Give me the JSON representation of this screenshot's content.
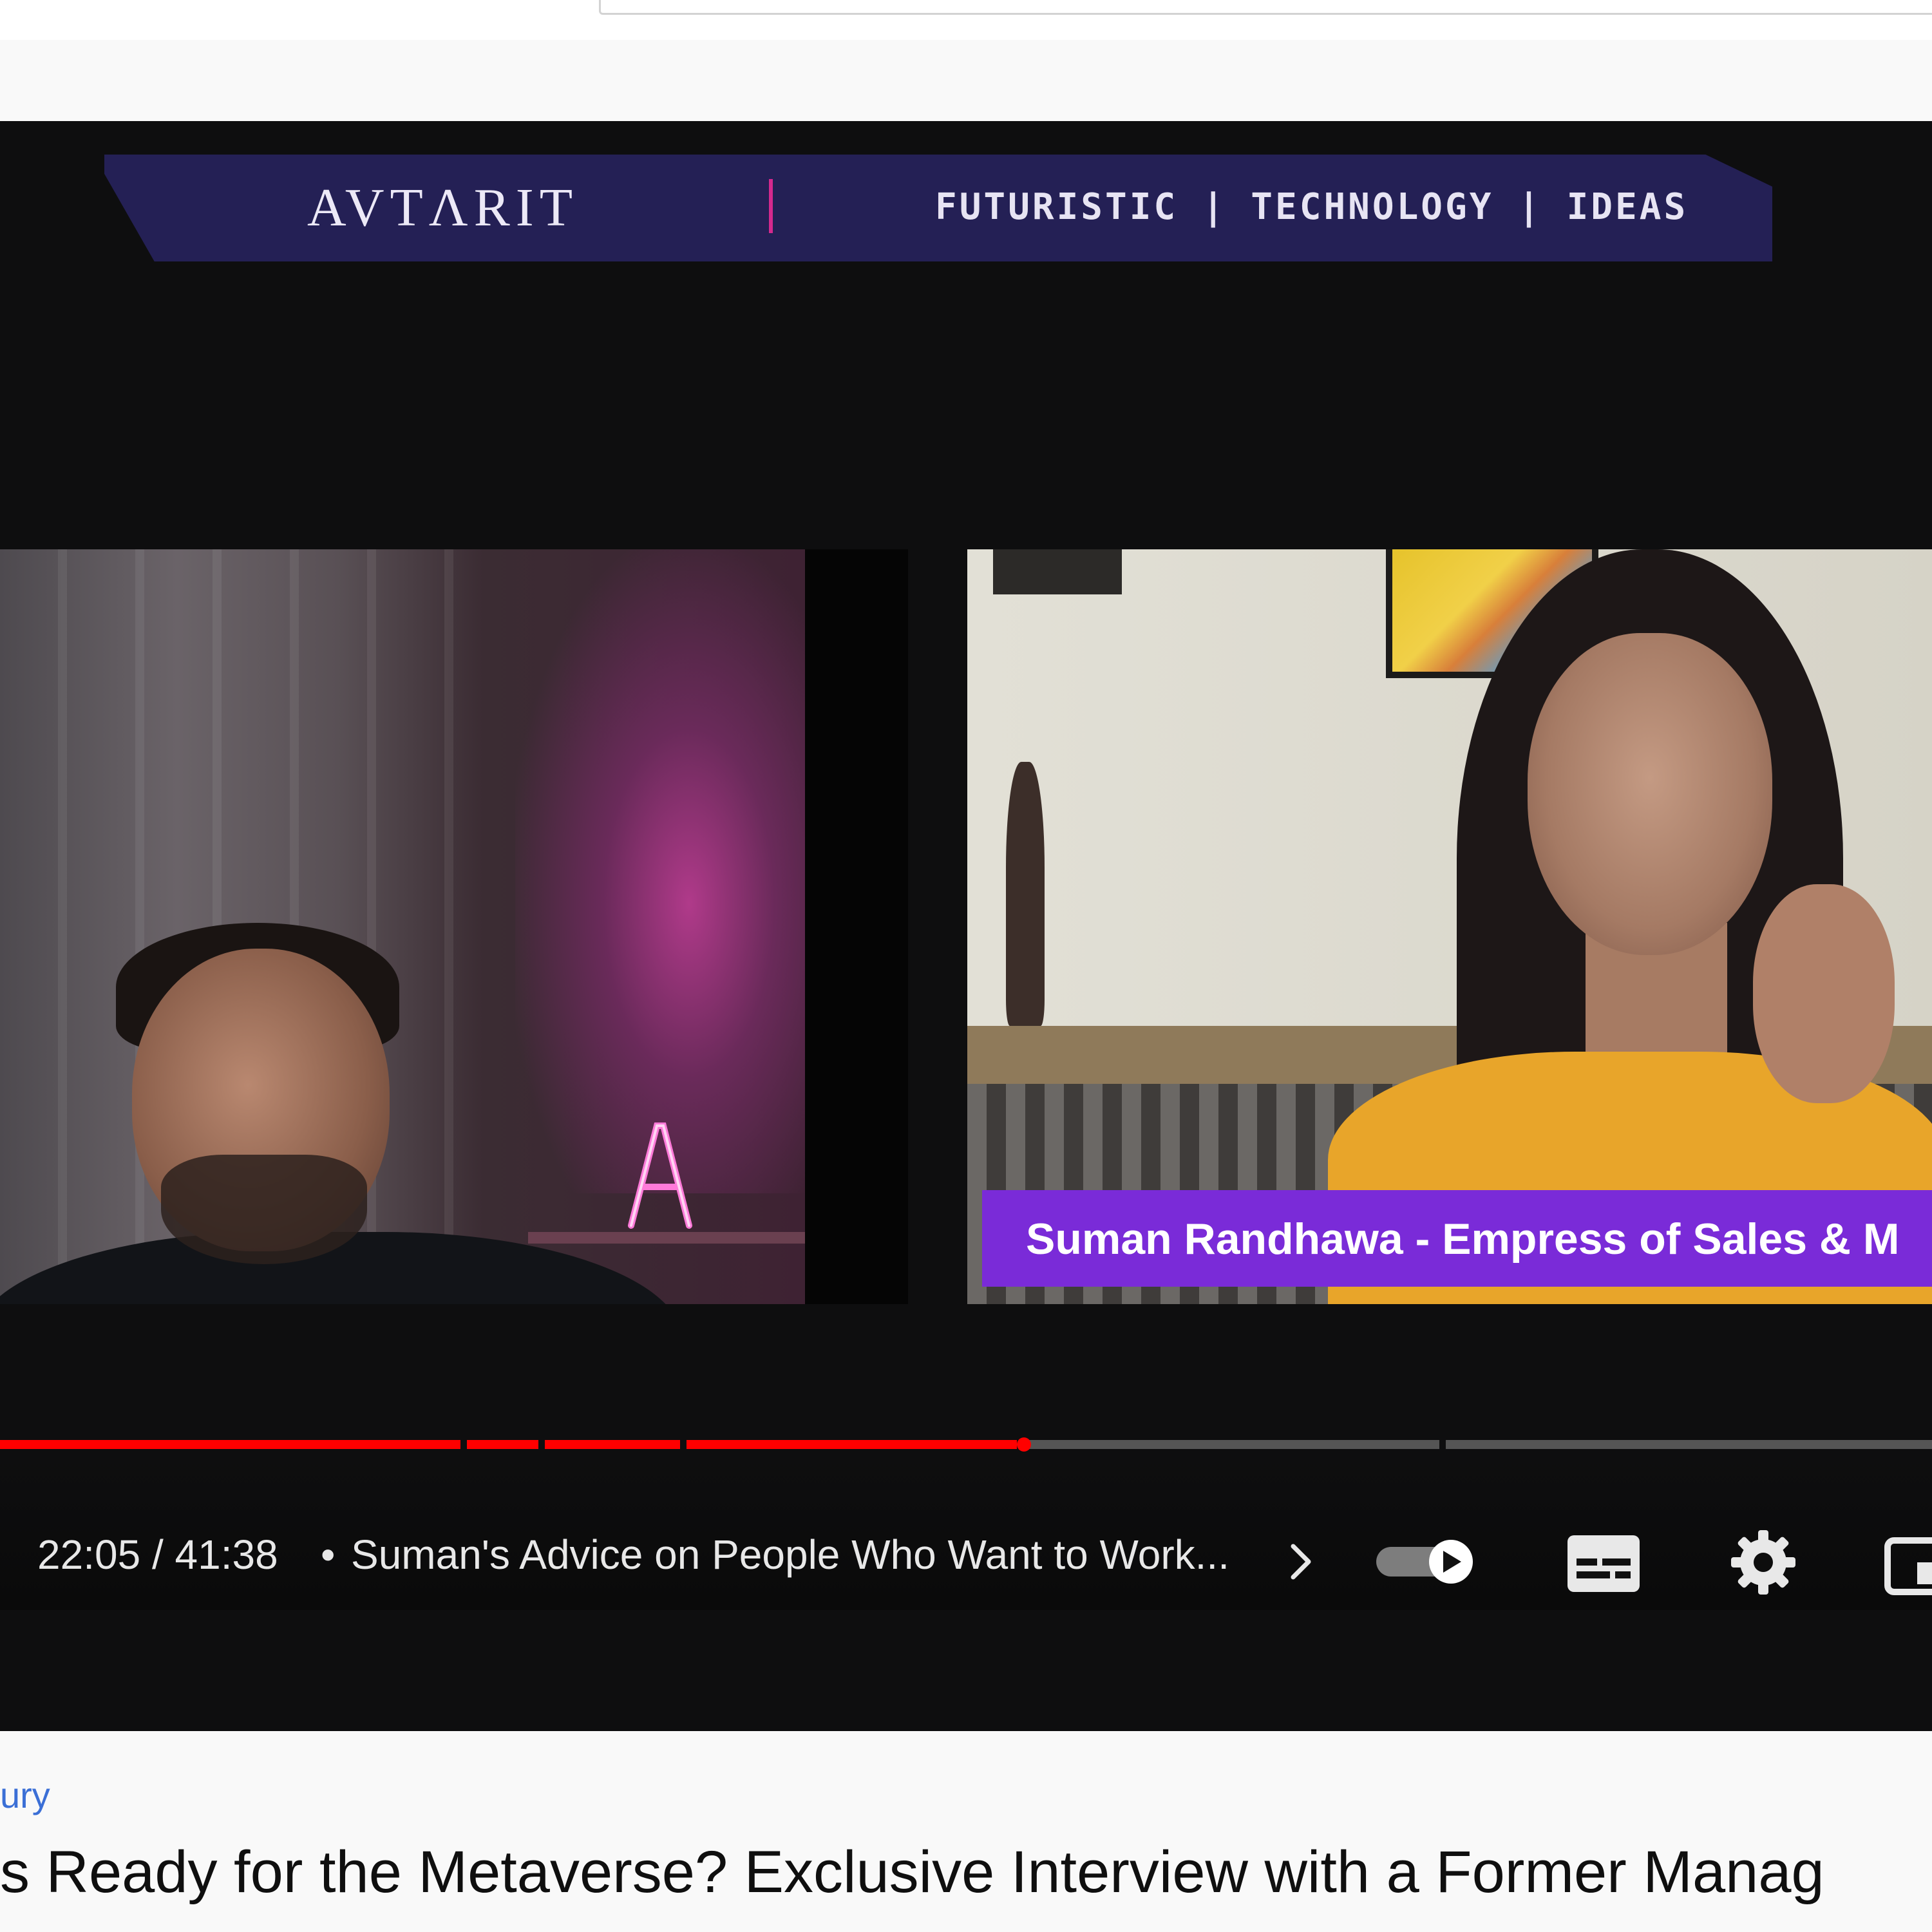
{
  "banner": {
    "brand": "AVTΛRIT",
    "tagline": "FUTURISTIC | TECHNOLOGY | IDEAS"
  },
  "video": {
    "name_tag": "Suman Randhawa - Empress of Sales & M"
  },
  "player": {
    "current_time": "22:05",
    "separator": "/",
    "duration": "41:38",
    "chapter_bullet": "•",
    "chapter_title": "Suman's Advice on People Who Want to Work...",
    "progress_fraction": 0.53,
    "chapter_segments": [
      0.24,
      0.04,
      0.073,
      0.173,
      0.0,
      0.217,
      0.25
    ],
    "icons": [
      "chevron-right-icon",
      "autoplay-toggle",
      "captions-icon",
      "settings-icon",
      "miniplayer-icon"
    ],
    "colors": {
      "played": "#ff0000",
      "unplayed": "#555555",
      "name_tag": "#7a2bd8"
    }
  },
  "page": {
    "channel_fragment": "ury",
    "title_fragment": "s Ready for the Metaverse? Exclusive Interview with a Former Manag"
  }
}
